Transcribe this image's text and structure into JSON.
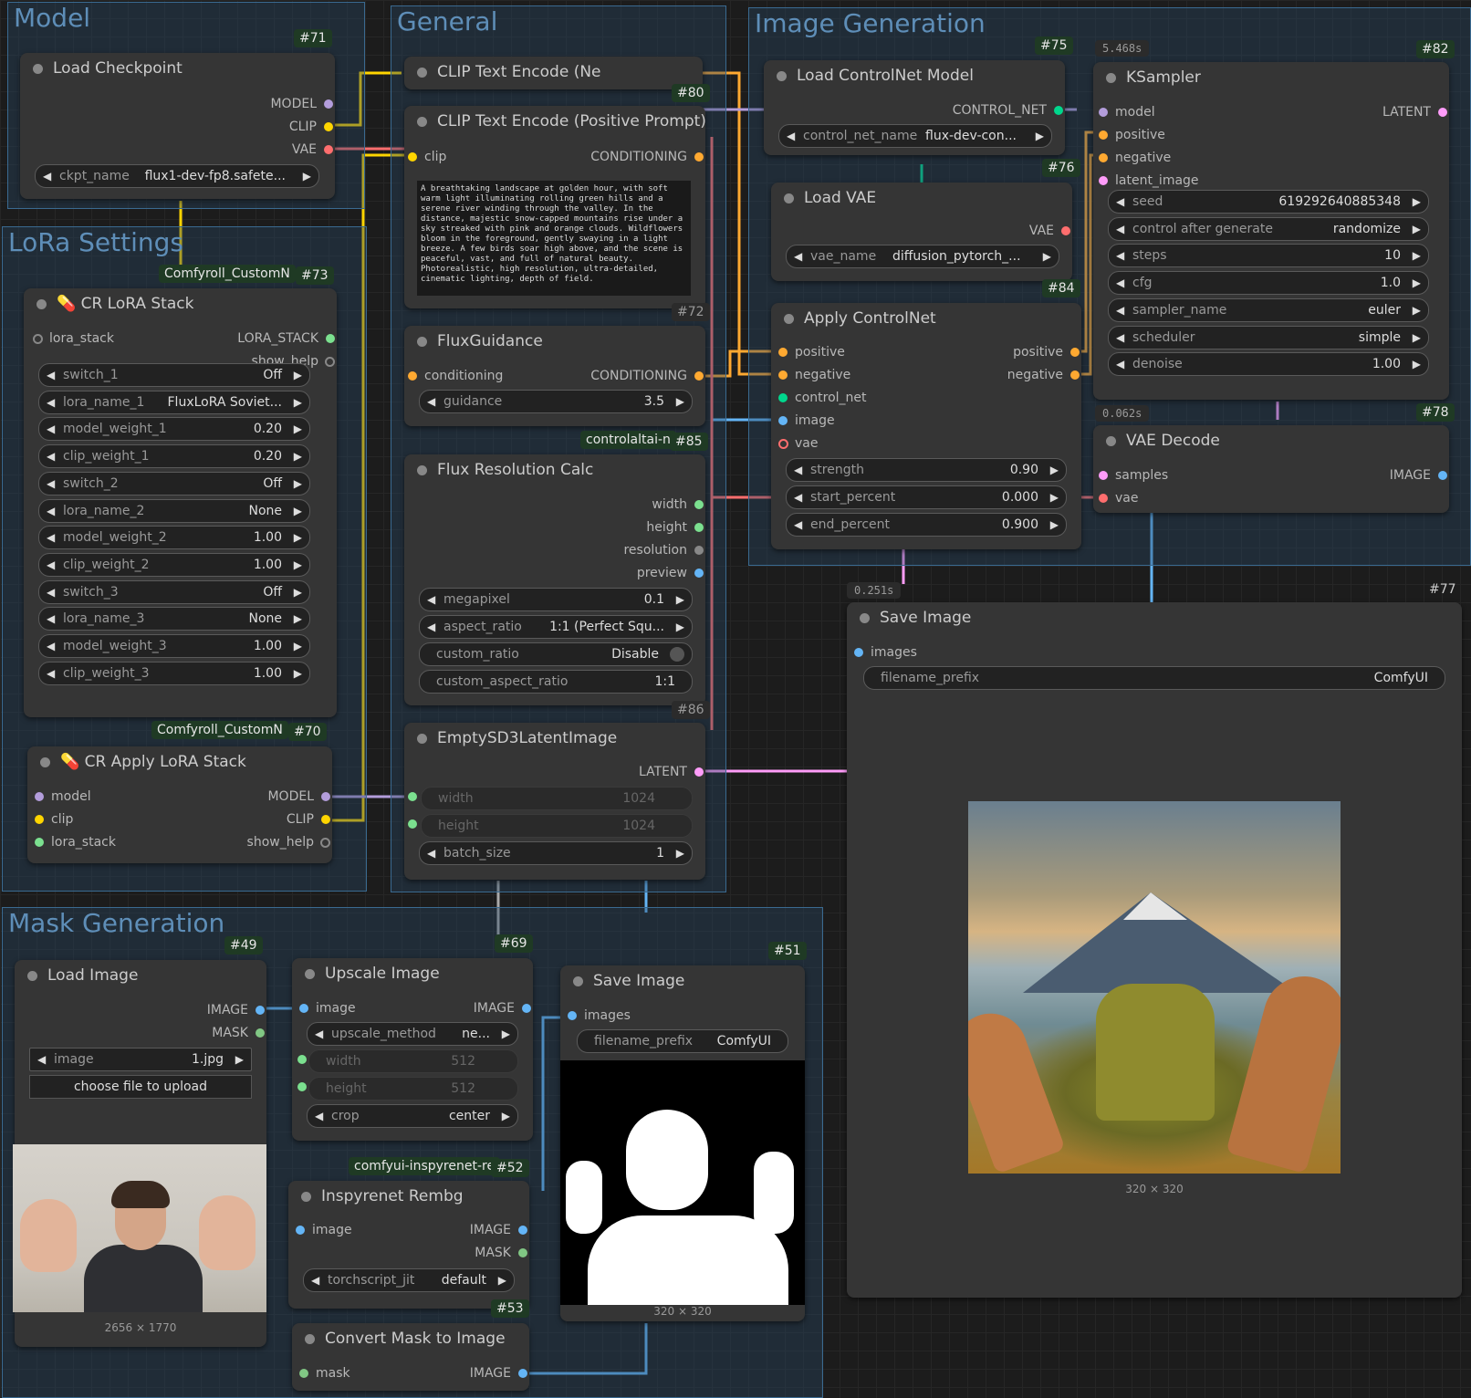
{
  "groups": {
    "model": "Model",
    "general": "General",
    "image_generation": "Image Generation",
    "lora_settings": "LoRa Settings",
    "mask_generation": "Mask Generation"
  },
  "nodes": {
    "load_checkpoint": {
      "title": "Load Checkpoint",
      "id": "#71",
      "outputs": [
        "MODEL",
        "CLIP",
        "VAE"
      ],
      "ckpt_label": "ckpt_name",
      "ckpt_value": "flux1-dev-fp8.safete..."
    },
    "cr_lora_stack": {
      "title": "CR LoRA Stack",
      "id": "#73",
      "type_badge": "Comfyroll_CustomN",
      "input": "lora_stack",
      "outputs": [
        "LORA_STACK",
        "show_help"
      ],
      "widgets": [
        {
          "label": "switch_1",
          "value": "Off"
        },
        {
          "label": "lora_name_1",
          "value": "FluxLoRA Soviet..."
        },
        {
          "label": "model_weight_1",
          "value": "0.20"
        },
        {
          "label": "clip_weight_1",
          "value": "0.20"
        },
        {
          "label": "switch_2",
          "value": "Off"
        },
        {
          "label": "lora_name_2",
          "value": "None"
        },
        {
          "label": "model_weight_2",
          "value": "1.00"
        },
        {
          "label": "clip_weight_2",
          "value": "1.00"
        },
        {
          "label": "switch_3",
          "value": "Off"
        },
        {
          "label": "lora_name_3",
          "value": "None"
        },
        {
          "label": "model_weight_3",
          "value": "1.00"
        },
        {
          "label": "clip_weight_3",
          "value": "1.00"
        }
      ]
    },
    "cr_apply_lora_stack": {
      "title": "CR Apply LoRA Stack",
      "id": "#70",
      "type_badge": "Comfyroll_CustomN",
      "inputs": [
        "model",
        "clip",
        "lora_stack"
      ],
      "outputs": [
        "MODEL",
        "CLIP",
        "show_help"
      ]
    },
    "clip_text_encode_neg": {
      "title": "CLIP Text Encode (Ne"
    },
    "clip_text_encode_pos": {
      "title": "CLIP Text Encode (Positive Prompt)",
      "id": "#80",
      "input": "clip",
      "output": "CONDITIONING",
      "text": "A breathtaking landscape at golden hour, with soft warm light illuminating rolling green hills and a serene river winding through the valley. In the distance, majestic snow-capped mountains rise under a sky streaked with pink and orange clouds. Wildflowers bloom in the foreground, gently swaying in a light breeze. A few birds soar high above, and the scene is peaceful, vast, and full of natural beauty. Photorealistic, high resolution, ultra-detailed, cinematic lighting, depth of field."
    },
    "flux_guidance": {
      "title": "FluxGuidance",
      "id": "#72",
      "input": "conditioning",
      "output": "CONDITIONING",
      "guidance_label": "guidance",
      "guidance_value": "3.5"
    },
    "flux_resolution_calc": {
      "title": "Flux Resolution Calc",
      "id": "#85",
      "type_badge": "controlaltai-n",
      "outputs": [
        "width",
        "height",
        "resolution",
        "preview"
      ],
      "widgets": [
        {
          "label": "megapixel",
          "value": "0.1"
        },
        {
          "label": "aspect_ratio",
          "value": "1:1 (Perfect Squ..."
        },
        {
          "label": "custom_ratio",
          "value": "Disable"
        },
        {
          "label": "custom_aspect_ratio",
          "value": "1:1"
        }
      ]
    },
    "empty_sd3_latent": {
      "title": "EmptySD3LatentImage",
      "id": "#86",
      "output": "LATENT",
      "widgets": [
        {
          "label": "width",
          "value": "1024"
        },
        {
          "label": "height",
          "value": "1024"
        },
        {
          "label": "batch_size",
          "value": "1"
        }
      ]
    },
    "load_controlnet": {
      "title": "Load ControlNet Model",
      "id": "#75",
      "output": "CONTROL_NET",
      "widget_label": "control_net_name",
      "widget_value": "flux-dev-con..."
    },
    "load_vae": {
      "title": "Load VAE",
      "id": "#76",
      "output": "VAE",
      "widget_label": "vae_name",
      "widget_value": "diffusion_pytorch_..."
    },
    "apply_controlnet": {
      "title": "Apply ControlNet",
      "id": "#84",
      "inputs": [
        "positive",
        "negative",
        "control_net",
        "image",
        "vae"
      ],
      "outputs": [
        "positive",
        "negative"
      ],
      "widgets": [
        {
          "label": "strength",
          "value": "0.90"
        },
        {
          "label": "start_percent",
          "value": "0.000"
        },
        {
          "label": "end_percent",
          "value": "0.900"
        }
      ]
    },
    "ksampler": {
      "title": "KSampler",
      "id": "#82",
      "timing": "5.468s",
      "inputs": [
        "model",
        "positive",
        "negative",
        "latent_image"
      ],
      "output": "LATENT",
      "widgets": [
        {
          "label": "seed",
          "value": "619292640885348"
        },
        {
          "label": "control after generate",
          "value": "randomize"
        },
        {
          "label": "steps",
          "value": "10"
        },
        {
          "label": "cfg",
          "value": "1.0"
        },
        {
          "label": "sampler_name",
          "value": "euler"
        },
        {
          "label": "scheduler",
          "value": "simple"
        },
        {
          "label": "denoise",
          "value": "1.00"
        }
      ]
    },
    "vae_decode": {
      "title": "VAE Decode",
      "id": "#78",
      "timing": "0.062s",
      "inputs": [
        "samples",
        "vae"
      ],
      "output": "IMAGE"
    },
    "save_image_main": {
      "title": "Save Image",
      "id": "#77",
      "timing": "0.251s",
      "input": "images",
      "prefix_label": "filename_prefix",
      "prefix_value": "ComfyUI",
      "dims": "320 × 320"
    },
    "load_image": {
      "title": "Load Image",
      "id": "#49",
      "outputs": [
        "IMAGE",
        "MASK"
      ],
      "image_label": "image",
      "image_value": "1.jpg",
      "upload_button": "choose file to upload",
      "dims": "2656 × 1770"
    },
    "upscale_image": {
      "title": "Upscale Image",
      "id": "#69",
      "input": "image",
      "output": "IMAGE",
      "widgets": [
        {
          "label": "upscale_method",
          "value": "ne..."
        },
        {
          "label": "width",
          "value": "512"
        },
        {
          "label": "height",
          "value": "512"
        },
        {
          "label": "crop",
          "value": "center"
        }
      ]
    },
    "save_image_mask": {
      "title": "Save Image",
      "id": "#51",
      "input": "images",
      "prefix_label": "filename_prefix",
      "prefix_value": "ComfyUI",
      "dims": "320 × 320"
    },
    "inspyrenet_rembg": {
      "title": "Inspyrenet Rembg",
      "id": "#52",
      "type_badge": "comfyui-inspyrenet-re",
      "input": "image",
      "outputs": [
        "IMAGE",
        "MASK"
      ],
      "widget_label": "torchscript_jit",
      "widget_value": "default"
    },
    "convert_mask": {
      "title": "Convert Mask to Image",
      "id": "#53",
      "input": "mask",
      "output": "IMAGE"
    }
  },
  "colors": {
    "model": "#b39ddb",
    "clip": "#ffd500",
    "vae": "#ff6e6e",
    "conditioning": "#ffa931",
    "latent": "#ff9cf9",
    "image": "#64b5f6",
    "mask": "#81c784",
    "int": "#7be08f",
    "control_net": "#00d78d"
  }
}
